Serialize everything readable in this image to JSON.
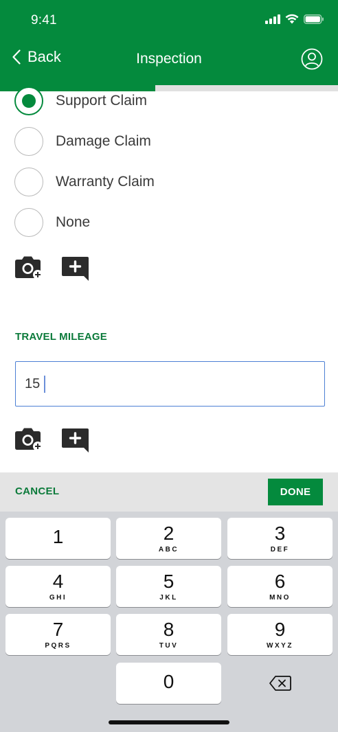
{
  "status_bar": {
    "time": "9:41"
  },
  "nav": {
    "back_label": "Back",
    "title": "Inspection"
  },
  "progress": {
    "fraction": 0.46
  },
  "claim_options": [
    {
      "label": "Support Claim",
      "selected": true
    },
    {
      "label": "Damage Claim",
      "selected": false
    },
    {
      "label": "Warranty Claim",
      "selected": false
    },
    {
      "label": "None",
      "selected": false
    }
  ],
  "icons": {
    "add_photo": "add-photo-icon",
    "add_comment": "add-comment-icon"
  },
  "travel_mileage": {
    "label": "TRAVEL MILEAGE",
    "value": "15"
  },
  "keyboard_toolbar": {
    "cancel_label": "CANCEL",
    "done_label": "DONE"
  },
  "keypad": {
    "keys": [
      {
        "digit": "1",
        "letters": ""
      },
      {
        "digit": "2",
        "letters": "ABC"
      },
      {
        "digit": "3",
        "letters": "DEF"
      },
      {
        "digit": "4",
        "letters": "GHI"
      },
      {
        "digit": "5",
        "letters": "JKL"
      },
      {
        "digit": "6",
        "letters": "MNO"
      },
      {
        "digit": "7",
        "letters": "PQRS"
      },
      {
        "digit": "8",
        "letters": "TUV"
      },
      {
        "digit": "9",
        "letters": "WXYZ"
      },
      {
        "digit": "0",
        "letters": ""
      }
    ]
  },
  "colors": {
    "brand_green": "#048a3d",
    "label_green": "#0b7a3a",
    "focus_blue": "#4c7fd4"
  }
}
